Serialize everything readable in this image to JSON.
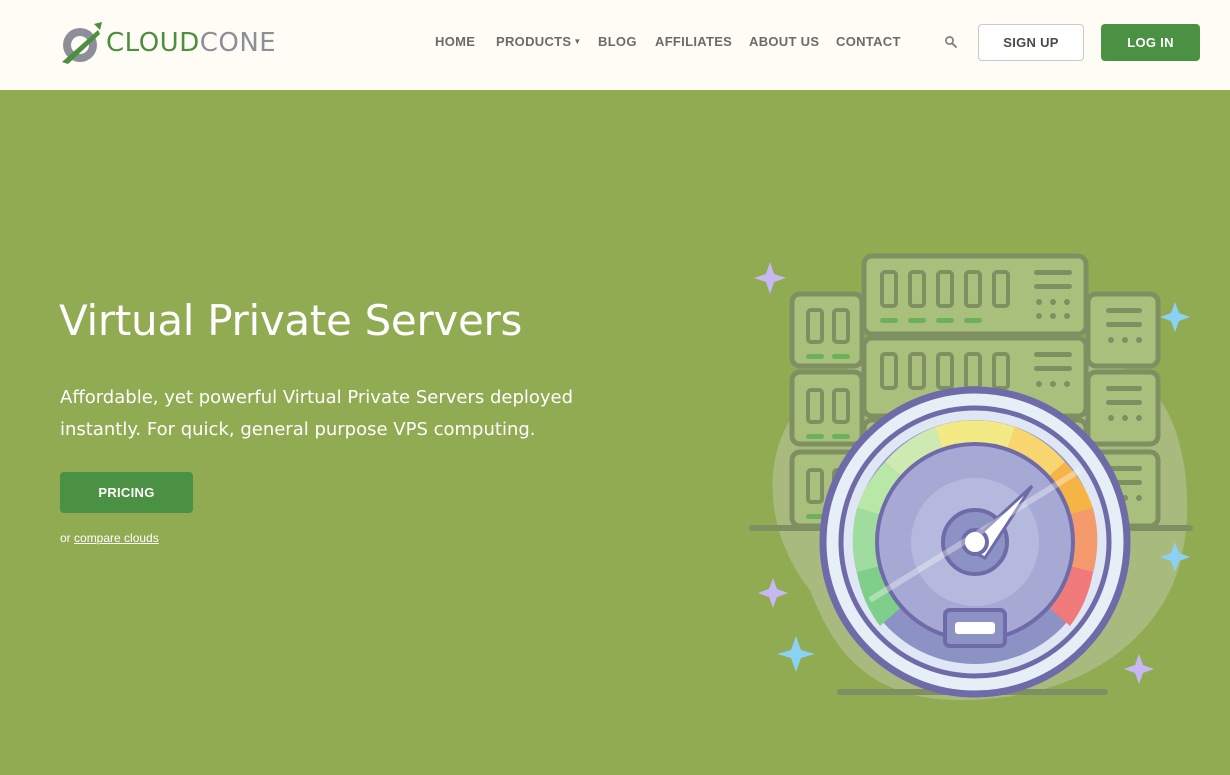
{
  "brand": {
    "word1": "CLOUD",
    "word2": "CONE",
    "colors": {
      "green": "#4b8f3f",
      "gray": "#8c8f98"
    }
  },
  "nav": {
    "items": [
      {
        "label": "HOME"
      },
      {
        "label": "PRODUCTS",
        "has_dropdown": true
      },
      {
        "label": "BLOG"
      },
      {
        "label": "AFFILIATES"
      },
      {
        "label": "ABOUT US"
      },
      {
        "label": "CONTACT"
      }
    ],
    "search_icon": "search-icon",
    "signup_label": "SIGN UP",
    "login_label": "LOG IN"
  },
  "hero": {
    "title": "Virtual Private Servers",
    "subtitle": "Affordable, yet powerful Virtual Private Servers deployed instantly. For quick, general purpose VPS computing.",
    "pricing_label": "PRICING",
    "compare_prefix": "or ",
    "compare_link": "compare clouds"
  },
  "colors": {
    "hero_bg": "#91ab53",
    "header_bg": "#fffcf5",
    "button_green": "#4b9143"
  }
}
